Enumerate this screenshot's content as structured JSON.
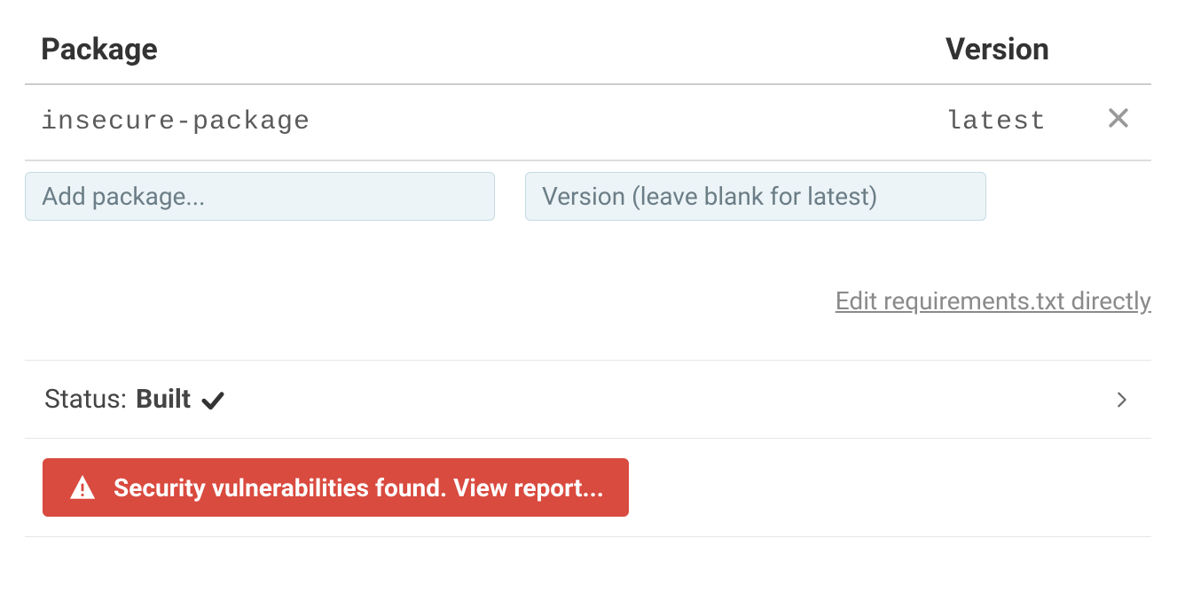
{
  "table": {
    "headers": {
      "package": "Package",
      "version": "Version"
    },
    "rows": [
      {
        "name": "insecure-package",
        "version": "latest"
      }
    ]
  },
  "inputs": {
    "package_placeholder": "Add package...",
    "version_placeholder": "Version (leave blank for latest)"
  },
  "links": {
    "edit_requirements": "Edit requirements.txt directly"
  },
  "status": {
    "label": "Status: ",
    "value": "Built"
  },
  "alert": {
    "text": "Security vulnerabilities found. View report..."
  }
}
